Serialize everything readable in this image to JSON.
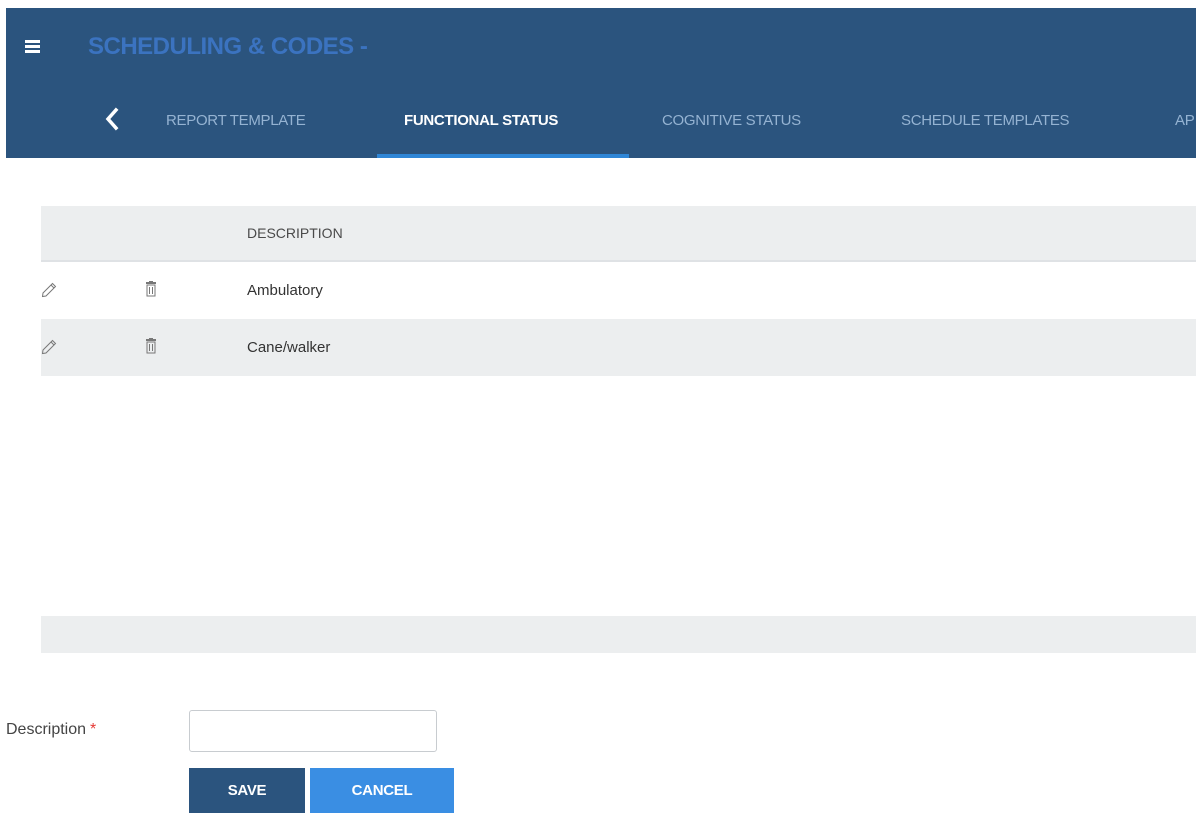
{
  "header": {
    "title": "SCHEDULING & CODES -"
  },
  "tabs": [
    {
      "label": "REPORT TEMPLATE",
      "active": false
    },
    {
      "label": "FUNCTIONAL STATUS",
      "active": true
    },
    {
      "label": "COGNITIVE STATUS",
      "active": false
    },
    {
      "label": "SCHEDULE TEMPLATES",
      "active": false
    },
    {
      "label": "AP",
      "active": false
    }
  ],
  "table": {
    "columns": [
      "",
      "",
      "DESCRIPTION"
    ],
    "rows": [
      {
        "description": "Ambulatory"
      },
      {
        "description": "Cane/walker"
      }
    ]
  },
  "form": {
    "description_label": "Description",
    "required_marker": "*",
    "description_value": "",
    "save_label": "SAVE",
    "cancel_label": "CANCEL"
  },
  "icons": {
    "menu": "hamburger-menu-icon",
    "back": "chevron-left-icon",
    "edit": "pencil-icon",
    "delete": "trash-icon"
  },
  "colors": {
    "header_bg": "#2b547e",
    "title": "#3b73c0",
    "tab_underline": "#2f86d6",
    "save_button": "#2b547e",
    "cancel_button": "#3a8ee3",
    "required": "#e53935"
  }
}
